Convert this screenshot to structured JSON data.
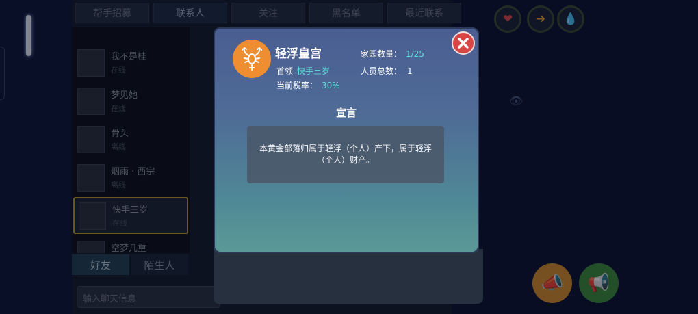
{
  "top_tabs": [
    "帮手招募",
    "联系人",
    "关注",
    "黑名单",
    "最近联系"
  ],
  "contacts": [
    {
      "name": "我不是桂",
      "status": "在线"
    },
    {
      "name": "梦见她",
      "status": "在线"
    },
    {
      "name": "骨头",
      "status": "离线"
    },
    {
      "name": "烟雨 · 西宗",
      "status": "离线"
    },
    {
      "name": "快手三岁",
      "status": "在线"
    },
    {
      "name": "空梦几重",
      "status": ""
    }
  ],
  "bottom_tabs": {
    "friends": "好友",
    "strangers": "陌生人"
  },
  "message_input": {
    "placeholder": "输入聊天信息"
  },
  "guild": {
    "name": "轻浮皇宫",
    "leader_label": "首领",
    "leader_value": "快手三岁",
    "tax_label": "当前税率：",
    "tax_value": "30%",
    "homes_label": "家园数量：",
    "homes_value": "1/25",
    "members_label": "人员总数：",
    "members_value": "1",
    "emblem_icon": "scorpion-icon",
    "emblem_color": "#ee8e31"
  },
  "declaration": {
    "title": "宣言",
    "text": "本黄金部落归属于轻浮（个人）产下，属于轻浮（个人）财产。"
  },
  "colors": {
    "accent_cyan": "#5ee0d9",
    "close_red": "#d84545",
    "selected_border": "#b89a2c"
  }
}
